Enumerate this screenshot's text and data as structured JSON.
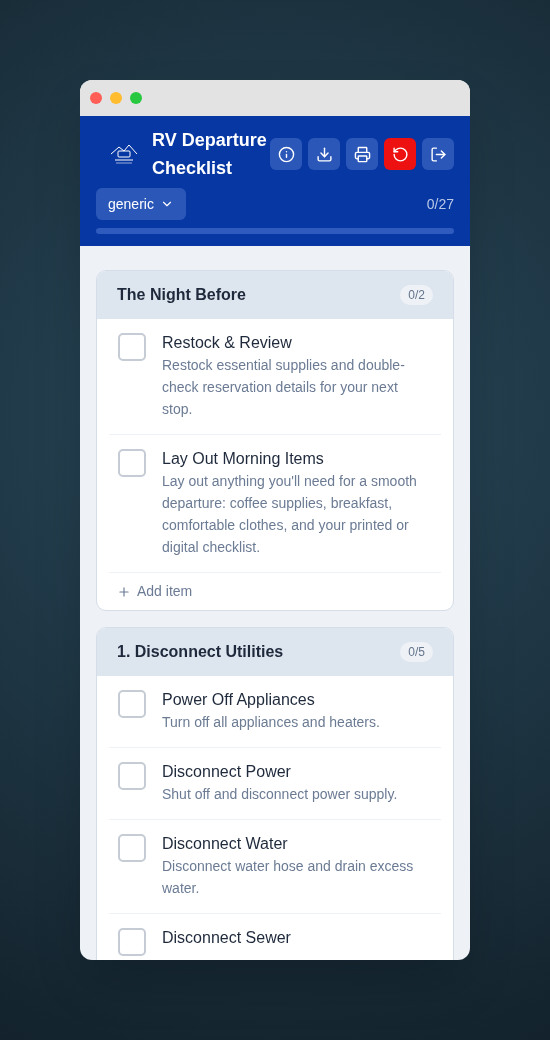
{
  "header": {
    "title": "RV Departure Checklist",
    "actions": [
      {
        "kind": "info"
      },
      {
        "kind": "download"
      },
      {
        "kind": "print"
      },
      {
        "kind": "reset"
      },
      {
        "kind": "logout"
      }
    ],
    "profile": "generic",
    "progress_text": "0/27",
    "progress": {
      "level": 0
    }
  },
  "sections": [
    {
      "title": "The Night Before",
      "count": "0/2",
      "items": [
        {
          "title": "Restock & Review",
          "description": "Restock essential supplies and double-check reservation details for your next stop.",
          "checked": false
        },
        {
          "title": "Lay Out Morning Items",
          "description": "Lay out anything you'll need for a smooth departure: coffee supplies, breakfast, comfortable clothes, and your printed or digital checklist.",
          "checked": false
        }
      ],
      "add_label": "Add item"
    },
    {
      "title": "1. Disconnect Utilities",
      "count": "0/5",
      "items": [
        {
          "title": "Power Off Appliances",
          "description": "Turn off all appliances and heaters.",
          "checked": false
        },
        {
          "title": "Disconnect Power",
          "description": "Shut off and disconnect power supply.",
          "checked": false
        },
        {
          "title": "Disconnect Water",
          "description": "Disconnect water hose and drain excess water.",
          "checked": false
        },
        {
          "title": "Disconnect Sewer",
          "checked": false
        }
      ]
    }
  ]
}
